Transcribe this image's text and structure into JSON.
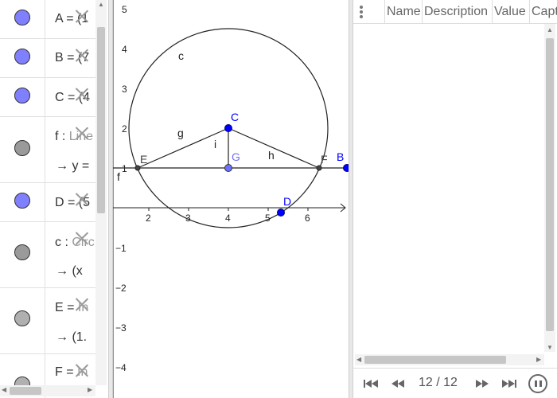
{
  "algebra": {
    "rows": [
      {
        "id": "A",
        "line1": "A = (1",
        "caption": "",
        "line2": "",
        "dot_color": "#8080ff"
      },
      {
        "id": "B",
        "line1": "B = (7",
        "caption": "",
        "line2": "",
        "dot_color": "#8080ff"
      },
      {
        "id": "C",
        "line1": "C = (4",
        "caption": "",
        "line2": "",
        "dot_color": "#8080ff"
      },
      {
        "id": "f",
        "line1": "f : ",
        "caption": "Line",
        "line2": "→ y =",
        "dot_color": "#9a9a9a"
      },
      {
        "id": "D",
        "line1": "D = (5",
        "caption": "",
        "line2": "",
        "dot_color": "#8080ff"
      },
      {
        "id": "c",
        "line1": "c : ",
        "caption": "Circ",
        "line2": "→ (x",
        "dot_color": "#9a9a9a"
      },
      {
        "id": "E",
        "line1": "E = ",
        "caption": "In",
        "line2": "→ (1.",
        "dot_color": "#b0b0b0"
      },
      {
        "id": "F",
        "line1": "F = ",
        "caption": "In",
        "line2": "",
        "dot_color": "#b0b0b0"
      }
    ]
  },
  "graphics": {
    "x_ticks": [
      "2",
      "3",
      "4",
      "5",
      "6"
    ],
    "y_ticks": [
      "5",
      "4",
      "3",
      "2",
      "1",
      "−1",
      "−2",
      "−3",
      "−4"
    ],
    "point_labels": {
      "C": "C",
      "G": "G",
      "E": "E",
      "F": "F",
      "B": "B",
      "D": "D"
    },
    "object_labels": {
      "c": "c",
      "g": "g",
      "i": "i",
      "h": "h",
      "f": "f"
    },
    "colors": {
      "free_point": "#0000ff",
      "dependent_point": "#444444",
      "point_G": "#7070ff",
      "label_G": "#7070ff",
      "axis": "#222222"
    }
  },
  "protocol": {
    "columns": [
      "Name",
      "Description",
      "Value",
      "Capt"
    ],
    "navigation": {
      "step": "12 / 12"
    }
  }
}
